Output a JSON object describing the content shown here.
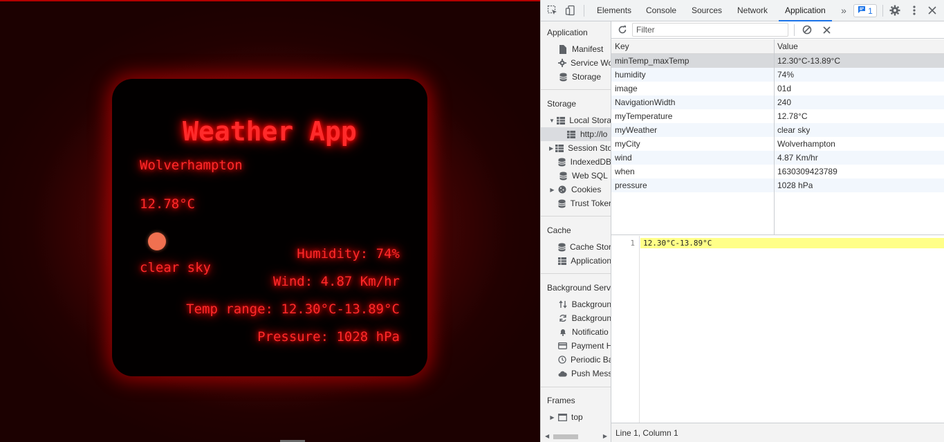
{
  "weather": {
    "app_title": "Weather App",
    "city": "Wolverhampton",
    "temperature": "12.78°C",
    "icon": "sun-icon",
    "description": "clear sky",
    "humidity": "Humidity: 74%",
    "wind": "Wind: 4.87 Km/hr",
    "temp_range": "Temp range: 12.30°C-13.89°C",
    "pressure": "Pressure: 1028 hPa",
    "glow_color": "#ff2a2a"
  },
  "devtools": {
    "tabs": [
      {
        "label": "Elements"
      },
      {
        "label": "Console"
      },
      {
        "label": "Sources"
      },
      {
        "label": "Network"
      },
      {
        "label": "Application",
        "active": true
      }
    ],
    "issues_count": "1",
    "sidebar": {
      "application_title": "Application",
      "application_items": [
        "Manifest",
        "Service Wo",
        "Storage"
      ],
      "storage_title": "Storage",
      "storage_items": [
        "Local Stora",
        "http://lo",
        "Session Sto",
        "IndexedDB",
        "Web SQL",
        "Cookies",
        "Trust Toker"
      ],
      "cache_title": "Cache",
      "cache_items": [
        "Cache Stor",
        "Application"
      ],
      "background_title": "Background Servi",
      "background_items": [
        "Backgroun",
        "Backgroun",
        "Notificatio",
        "Payment H",
        "Periodic Ba",
        "Push Mess"
      ],
      "frames_title": "Frames",
      "frames_items": [
        "top"
      ]
    },
    "filter_placeholder": "Filter",
    "table": {
      "headers": {
        "key": "Key",
        "value": "Value"
      },
      "rows": [
        {
          "key": "minTemp_maxTemp",
          "value": "12.30°C-13.89°C"
        },
        {
          "key": "humidity",
          "value": "74%"
        },
        {
          "key": "image",
          "value": "01d"
        },
        {
          "key": "NavigationWidth",
          "value": "240"
        },
        {
          "key": "myTemperature",
          "value": "12.78°C"
        },
        {
          "key": "myWeather",
          "value": "clear sky"
        },
        {
          "key": "myCity",
          "value": "Wolverhampton"
        },
        {
          "key": "wind",
          "value": "4.87 Km/hr"
        },
        {
          "key": "when",
          "value": "1630309423789"
        },
        {
          "key": "pressure",
          "value": "1028 hPa"
        }
      ]
    },
    "preview": {
      "line_number": "1",
      "line_text": "12.30°C-13.89°C"
    },
    "status": "Line 1, Column 1",
    "accent_color": "#1a73e8"
  }
}
